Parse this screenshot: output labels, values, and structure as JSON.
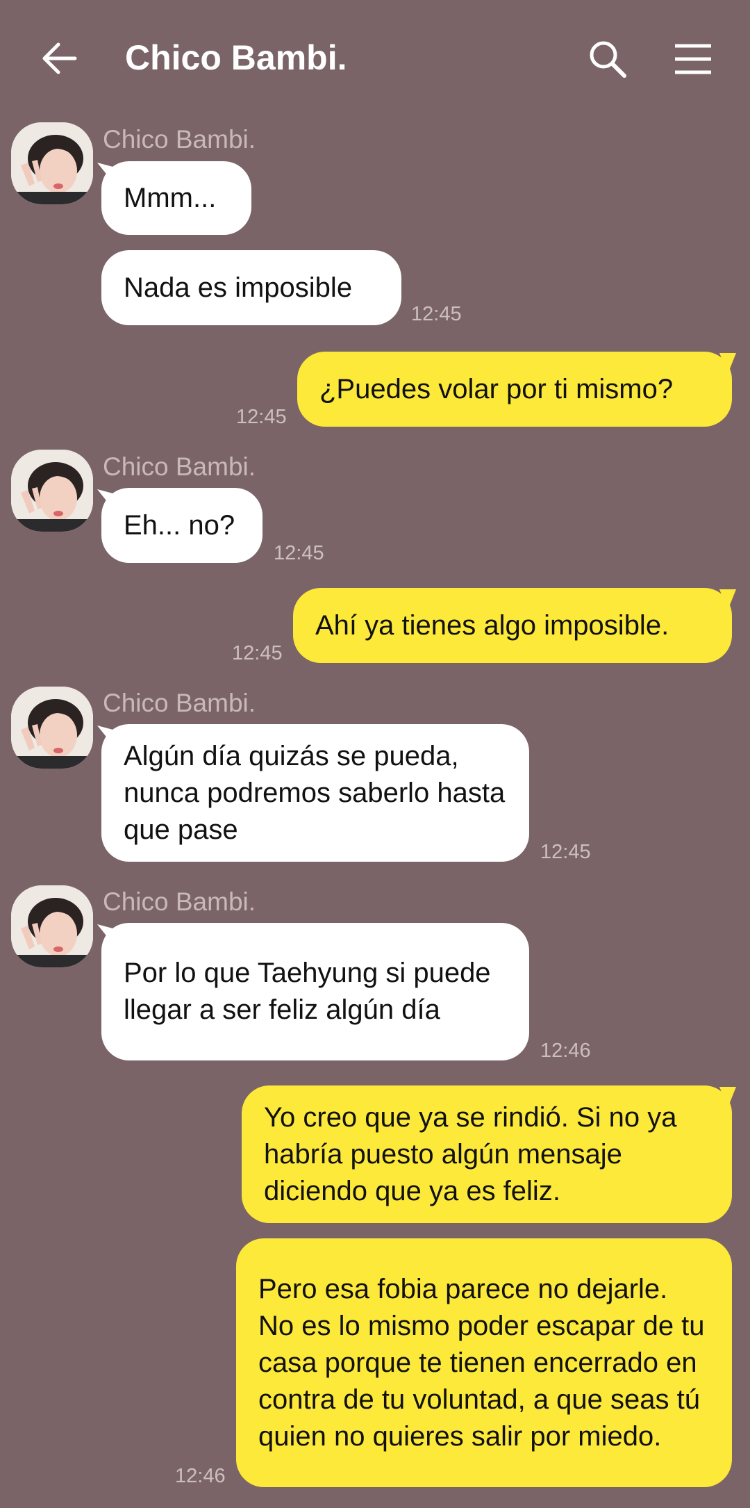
{
  "header": {
    "title": "Chico Bambi.",
    "icons": [
      "back-arrow-icon",
      "search-icon",
      "menu-icon"
    ]
  },
  "colors": {
    "background": "#7b6468",
    "incoming_bubble": "#ffffff",
    "outgoing_bubble": "#fde93a"
  },
  "messages": [
    {
      "sender": "Chico Bambi.",
      "text": "Mmm...",
      "time": ""
    },
    {
      "sender": "",
      "text": "Nada es imposible",
      "time": "12:45"
    },
    {
      "sender": "",
      "text": "¿Puedes volar por ti mismo?",
      "time": "12:45"
    },
    {
      "sender": "Chico Bambi.",
      "text": "Eh... no?",
      "time": "12:45"
    },
    {
      "sender": "",
      "text": "Ahí ya tienes algo imposible.",
      "time": "12:45"
    },
    {
      "sender": "Chico Bambi.",
      "text": "Algún día quizás se pueda, nunca podremos saberlo hasta que pase",
      "time": "12:45"
    },
    {
      "sender": "Chico Bambi.",
      "text": "Por lo que Taehyung si puede llegar a ser feliz algún día",
      "time": "12:46"
    },
    {
      "sender": "",
      "text": "Yo creo que ya se rindió. Si no ya habría puesto algún mensaje diciendo que ya es feliz.",
      "time": ""
    },
    {
      "sender": "",
      "text": "Pero esa fobia parece no dejarle. No es lo mismo poder escapar de tu casa porque te tienen encerrado en contra de tu voluntad, a que seas tú quien no quieres salir por miedo.",
      "time": "12:46"
    }
  ]
}
